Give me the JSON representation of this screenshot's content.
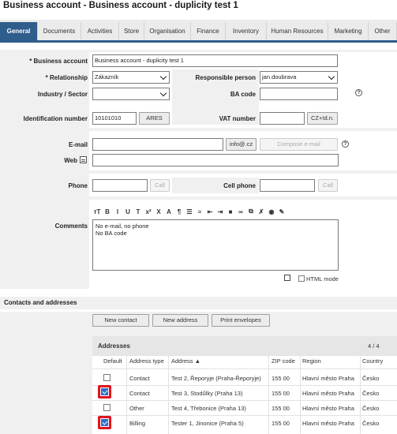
{
  "window_title": "Business account - Business account - duplicity test 1",
  "tabs": [
    "General",
    "Documents",
    "Activities",
    "Store",
    "Organisation",
    "Finance",
    "Inventory",
    "Human Resources",
    "Marketing",
    "Other"
  ],
  "form": {
    "business_account_label": "* Business account",
    "business_account_value": "Business account - duplicity test 1",
    "relationship_label": "* Relationship",
    "relationship_value": "Zákazník",
    "responsible_person_label": "Responsible person",
    "responsible_person_value": "jan.doubrava",
    "industry_label": "Industry / Sector",
    "industry_value": "",
    "ba_code_label": "BA code",
    "ba_code_value": "",
    "id_number_label": "Identification number",
    "id_number_value": "10101010",
    "ares_button": "ARES",
    "vat_label": "VAT number",
    "vat_value": "",
    "cz_id_button": "CZ+Id.n.",
    "email_label": "E-mail",
    "email_value": "",
    "info_button": "info@.cz",
    "compose_button": "Compose e-mail",
    "web_label": "Web",
    "web_value": "",
    "phone_label": "Phone",
    "phone_value": "",
    "call_button": "Call",
    "cell_label": "Cell phone",
    "cell_value": "",
    "cell_call_button": "Call",
    "comments_label": "Comments",
    "comments_line1": "No e-mail, no phone",
    "comments_line2": "No BA code",
    "html_mode_label": "HTML mode",
    "help_glyph": "?"
  },
  "toolbar_icons": [
    "text-size",
    "bold",
    "italic",
    "underline",
    "strikethrough",
    "superscript",
    "clear-format",
    "font-color",
    "paragraph",
    "ordered-list",
    "unordered-list",
    "outdent",
    "indent",
    "image",
    "link",
    "unlink",
    "remove-format",
    "preview",
    "edit"
  ],
  "toolbar_glyphs": [
    "тT",
    "B",
    "I",
    "U",
    "T",
    "x²",
    "X",
    "A",
    "¶",
    "☰",
    "≡",
    "⇤",
    "⇥",
    "■",
    "∞",
    "⧉",
    "✗",
    "◉",
    "✎"
  ],
  "contacts_section": {
    "title": "Contacts and addresses",
    "new_contact": "New contact",
    "new_address": "New address",
    "print_envelopes": "Print envelopes",
    "addresses_title": "Addresses",
    "count": "4 / 4",
    "columns": [
      "Default",
      "Address type",
      "Address",
      "ZIP code",
      "Region",
      "Country"
    ],
    "rows": [
      {
        "default": false,
        "type": "Contact",
        "address": "Test 2, Řeporyje (Praha-Řeporyje)",
        "zip": "155 00",
        "region": "Hlavní město Praha",
        "country": "Česko"
      },
      {
        "default": true,
        "type": "Contact",
        "address": "Test 3, Stodůlky (Praha 13)",
        "zip": "155 00",
        "region": "Hlavní město Praha",
        "country": "Česko"
      },
      {
        "default": false,
        "type": "Other",
        "address": "Test 4, Třebonice (Praha 13)",
        "zip": "155 00",
        "region": "Hlavní město Praha",
        "country": "Česko"
      },
      {
        "default": true,
        "type": "Billing",
        "address": "Tester 1, Jinonice (Praha 5)",
        "zip": "155 00",
        "region": "Hlavní město Praha",
        "country": "Česko"
      }
    ]
  },
  "colors": {
    "accent": "#2f5d8c",
    "highlight": "#e0141e",
    "checkbox": "#2f6fc7"
  }
}
